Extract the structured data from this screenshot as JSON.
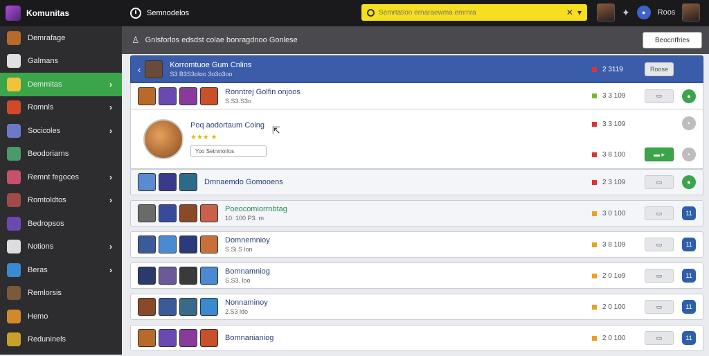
{
  "app": {
    "title": "Komunitas"
  },
  "top_nav": {
    "label": "Semnodelos"
  },
  "search": {
    "placeholder": "Semrtation ernaraewma emmra"
  },
  "top_user": {
    "name": "Roos"
  },
  "sidebar": {
    "items": [
      {
        "label": "Demrafage",
        "icon": "game-avatar-icon",
        "color": "#b86a2a",
        "active": false,
        "chevron": false
      },
      {
        "label": "Galmans",
        "icon": "grid-icon",
        "color": "#e0e0e0",
        "active": false,
        "chevron": false
      },
      {
        "label": "Demmitas",
        "icon": "community-icon",
        "color": "#f2c23a",
        "active": true,
        "chevron": true
      },
      {
        "label": "Romnls",
        "icon": "hero-icon",
        "color": "#d04a2a",
        "active": false,
        "chevron": true
      },
      {
        "label": "Socicoles",
        "icon": "map-icon",
        "color": "#6a7ac9",
        "active": false,
        "chevron": true
      },
      {
        "label": "Beodoriarns",
        "icon": "character-icon",
        "color": "#4a9a6a",
        "active": false,
        "chevron": false
      },
      {
        "label": "Remnt fegoces",
        "icon": "portrait-icon",
        "color": "#c9506a",
        "active": false,
        "chevron": true
      },
      {
        "label": "Romtoldtos",
        "icon": "warrior-icon",
        "color": "#a04a4a",
        "active": false,
        "chevron": true
      },
      {
        "label": "Bedropsos",
        "icon": "mage-icon",
        "color": "#6a4ab0",
        "active": false,
        "chevron": false
      },
      {
        "label": "Notions",
        "icon": "info-icon",
        "color": "#dddddd",
        "active": false,
        "chevron": true
      },
      {
        "label": "Beras",
        "icon": "landscape-icon",
        "color": "#3a8ad0",
        "active": false,
        "chevron": true
      },
      {
        "label": "Remlorsis",
        "icon": "knight-icon",
        "color": "#7a5a3a",
        "active": false,
        "chevron": false
      },
      {
        "label": "Hemo",
        "icon": "home-icon",
        "color": "#d08a2a",
        "active": false,
        "chevron": false
      },
      {
        "label": "Reduninels",
        "icon": "badge-icon",
        "color": "#c8a02a",
        "active": false,
        "chevron": false
      }
    ]
  },
  "subheader": {
    "title": "Gnlsforlos edsdst colae bonragdnoo Gonlese",
    "button_label": "Beocntfries"
  },
  "rows": [
    {
      "title": "Korromtuoe Gum Cnlins",
      "sub": "S3 B3S3oloo 3o3o3oo",
      "stat": "2 3119",
      "pill": "Roose",
      "type": "blue"
    },
    {
      "title": "Ronntrej Golfin onjoos",
      "sub": "S.S3.S3o",
      "stat": "3 3 109",
      "pill": "",
      "btn": "",
      "type": "normal"
    },
    {
      "title": "Poq aodortaum Coing",
      "sub": "",
      "stars": "★★★ ★",
      "input": "Yoo Setnmorlos",
      "stat1": "3 3 109",
      "stat2": "3 8 100",
      "pill": "",
      "type": "big"
    },
    {
      "title": "Dmnaemdo Gomooens",
      "sub": "",
      "stat": "2 3 109",
      "pill": "",
      "type": "light"
    },
    {
      "title": "Poeocomiorrnbtag",
      "sub": "10: 100 P3. m",
      "stat": "3 0 100",
      "pill": "",
      "btn": "11",
      "type": "light"
    },
    {
      "title": "Domnemnioy",
      "sub": "S.Si.S lon",
      "stat": "3 8 109",
      "pill": "",
      "btn": "11",
      "type": "normal"
    },
    {
      "title": "Bomnamniog",
      "sub": "S.S3. loo",
      "stat": "2 0 1o9",
      "pill": "",
      "btn": "11",
      "type": "normal"
    },
    {
      "title": "Nonnaminoy",
      "sub": "2.S3 ldo",
      "stat": "2 0 100",
      "pill": "",
      "btn": "11",
      "type": "normal"
    },
    {
      "title": "Bomnanianiog",
      "sub": "",
      "stat": "2 0 100",
      "pill": "",
      "btn": "11",
      "type": "normal"
    }
  ]
}
